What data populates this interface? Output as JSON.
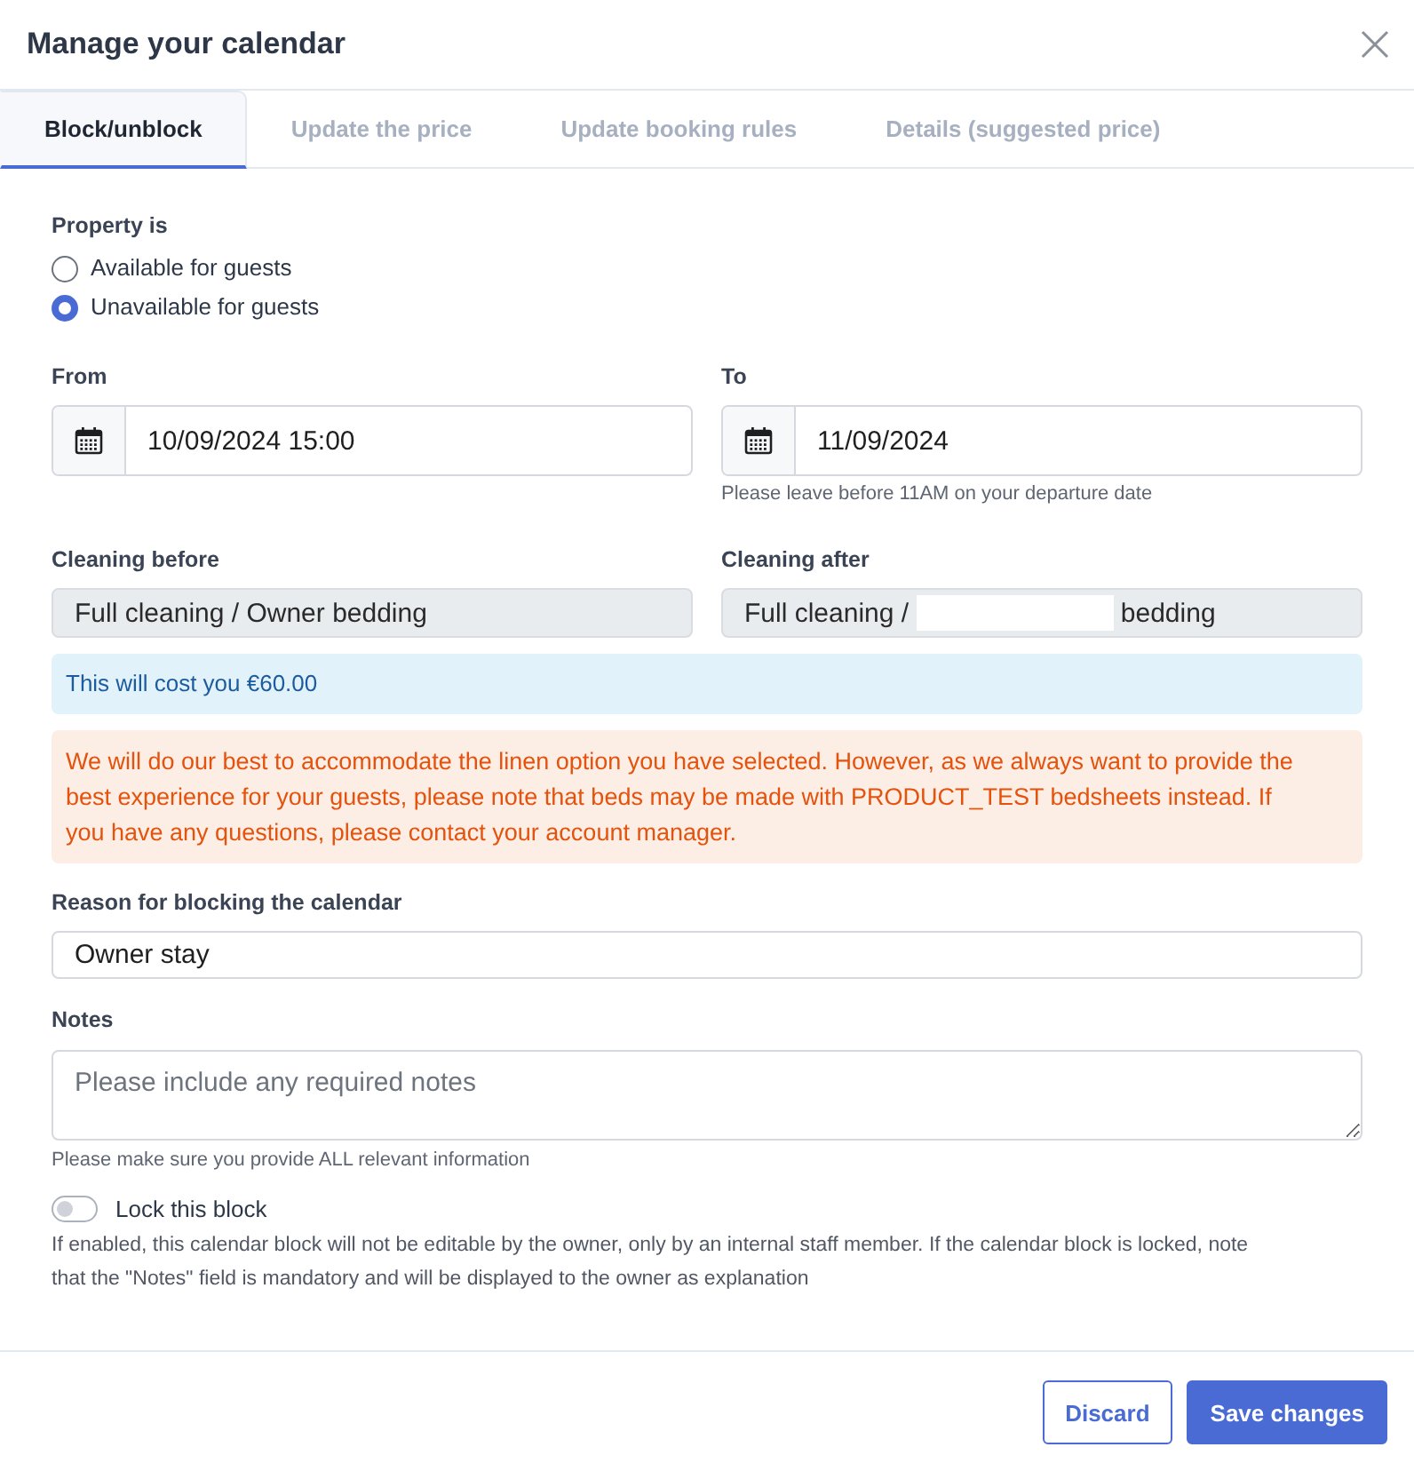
{
  "dialog": {
    "title": "Manage your calendar"
  },
  "tabs": [
    {
      "label": "Block/unblock",
      "selected": true
    },
    {
      "label": "Update the price",
      "selected": false
    },
    {
      "label": "Update booking rules",
      "selected": false
    },
    {
      "label": "Details (suggested price)",
      "selected": false
    }
  ],
  "availability": {
    "label": "Property is",
    "options": [
      {
        "label": "Available for guests",
        "selected": false
      },
      {
        "label": "Unavailable for guests",
        "selected": true
      }
    ]
  },
  "dates": [
    {
      "label": "From",
      "value": "10/09/2024 15:00"
    },
    {
      "label": "To",
      "value": "11/09/2024",
      "hint": "Please leave before 11AM on your departure date"
    }
  ],
  "cleaning": [
    {
      "label": "Cleaning before",
      "value": "Full cleaning / Owner bedding",
      "redacted": false
    },
    {
      "label": "Cleaning after",
      "value": "Full cleaning /",
      "redacted": true,
      "value_after": "bedding"
    }
  ],
  "cost_notice": "This will cost you €60.00",
  "linen_warning": "We will do our best to accommodate the linen option you have selected. However, as we always want to provide the best experience for your guests, please note that beds may be made with PRODUCT_TEST bedsheets instead. If you have any questions, please contact your account manager.",
  "reason": {
    "label": "Reason for blocking the calendar",
    "value": "Owner stay"
  },
  "notes": {
    "label": "Notes",
    "placeholder": "Please include any required notes",
    "hint": "Please make sure you provide ALL relevant information"
  },
  "lock": {
    "label": "Lock this block",
    "on": false,
    "description": "If enabled, this calendar block will not be editable by the owner, only by an internal staff member. If the calendar block is locked, note that the \"Notes\" field is mandatory and will be displayed to the owner as explanation"
  },
  "buttons": [
    {
      "label": "Discard",
      "kind": "secondary"
    },
    {
      "label": "Save changes",
      "kind": "primary"
    }
  ]
}
